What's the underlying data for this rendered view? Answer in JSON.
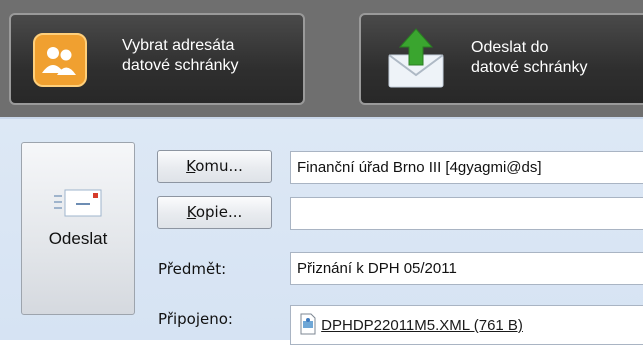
{
  "toolbar": {
    "select_recipient_label": "Vybrat adresáta\ndatové schránky",
    "send_to_box_label": "Odeslat do\ndatové schránky"
  },
  "form": {
    "send_label": "Odeslat",
    "to_button_label": "Komu...",
    "to_button_hotkey": "K",
    "to_button_rest": "omu...",
    "cc_button_hotkey": "K",
    "cc_button_rest": "opie...",
    "to_value": "Finanční úřad Brno III [4gyagmi@ds]",
    "cc_value": "",
    "subject_label": "Předmět:",
    "subject_value": "Přiznání k DPH 05/2011",
    "attached_label": "Připojeno:",
    "attachment_name": "DPHDP22011M5.XML (761 B)"
  },
  "colors": {
    "toolbar_bg": "#6f6f6f",
    "button_dark": "#2f2f2f",
    "form_bg": "#dde8f5",
    "icon_orange": "#f0a030",
    "icon_green": "#3aa52f"
  }
}
